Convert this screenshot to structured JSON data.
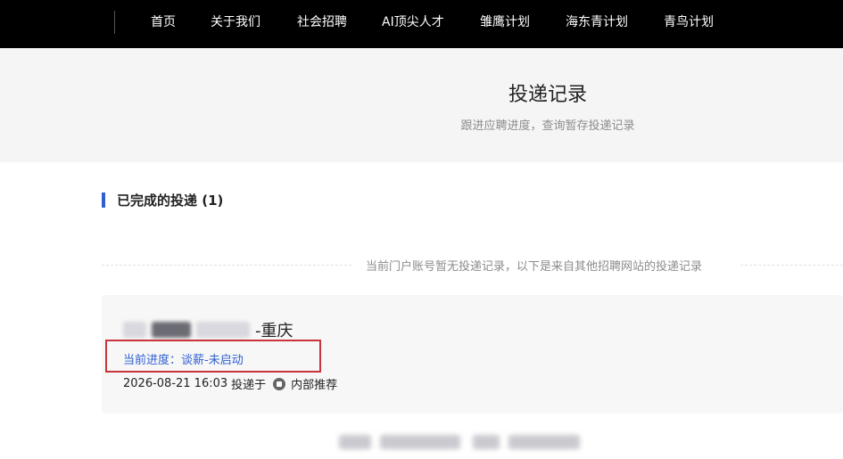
{
  "nav": {
    "items": [
      {
        "label": "首页"
      },
      {
        "label": "关于我们"
      },
      {
        "label": "社会招聘"
      },
      {
        "label": "AI顶尖人才"
      },
      {
        "label": "雏鹰计划"
      },
      {
        "label": "海东青计划"
      },
      {
        "label": "青鸟计划"
      }
    ]
  },
  "hero": {
    "title": "投递记录",
    "subtitle": "跟进应聘进度，查询暂存投递记录"
  },
  "section": {
    "title": "已完成的投递 (1)"
  },
  "notice": {
    "text": "当前门户账号暂无投递记录，以下是来自其他招聘网站的投递记录"
  },
  "application": {
    "title_suffix": "-重庆",
    "progress": "当前进度：谈薪-未启动",
    "submitted_time": "2026-08-21 16:03",
    "submitted_label": "投递于",
    "source_icon": "referral-icon",
    "source": "内部推荐"
  },
  "colors": {
    "accent": "#2f5fd0",
    "highlight_box": "#c9343a"
  }
}
